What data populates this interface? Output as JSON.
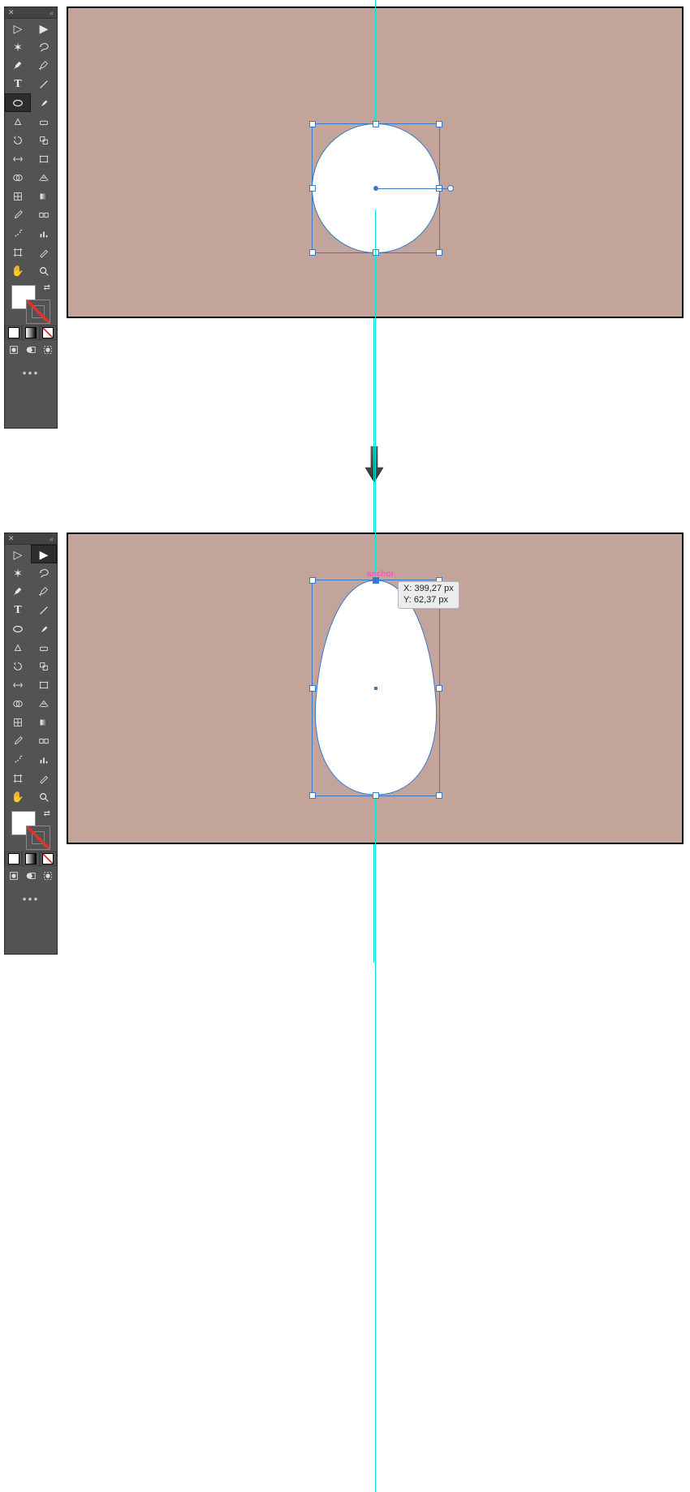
{
  "panel": {
    "title_hint": "toolbar"
  },
  "tools": [
    {
      "name": "selection-tool",
      "glyph": "▷"
    },
    {
      "name": "direct-selection-tool",
      "glyph": "▶"
    },
    {
      "name": "magic-wand-tool",
      "glyph": "✦"
    },
    {
      "name": "lasso-tool",
      "glyph": "∿"
    },
    {
      "name": "pen-tool",
      "glyph": "✒"
    },
    {
      "name": "curvature-tool",
      "glyph": "✎"
    },
    {
      "name": "type-tool",
      "glyph": "T"
    },
    {
      "name": "line-segment-tool",
      "glyph": "╱"
    },
    {
      "name": "ellipse-tool",
      "glyph": "◯"
    },
    {
      "name": "paintbrush-tool",
      "glyph": "🖌"
    },
    {
      "name": "shaper-tool",
      "glyph": "◇"
    },
    {
      "name": "eraser-tool",
      "glyph": "▭"
    },
    {
      "name": "rotate-tool",
      "glyph": "⟳"
    },
    {
      "name": "scale-tool",
      "glyph": "⤢"
    },
    {
      "name": "width-tool",
      "glyph": "↔"
    },
    {
      "name": "free-transform-tool",
      "glyph": "▱"
    },
    {
      "name": "shape-builder-tool",
      "glyph": "◐"
    },
    {
      "name": "perspective-grid-tool",
      "glyph": "▦"
    },
    {
      "name": "mesh-tool",
      "glyph": "▦"
    },
    {
      "name": "gradient-tool",
      "glyph": "▥"
    },
    {
      "name": "eyedropper-tool",
      "glyph": "⁃"
    },
    {
      "name": "blend-tool",
      "glyph": "◎"
    },
    {
      "name": "symbol-sprayer-tool",
      "glyph": "⁂"
    },
    {
      "name": "column-graph-tool",
      "glyph": "▥"
    },
    {
      "name": "slice-tool",
      "glyph": "▣"
    },
    {
      "name": "artboard-tool",
      "glyph": "▭"
    },
    {
      "name": "hand-tool",
      "glyph": "✋"
    },
    {
      "name": "zoom-tool",
      "glyph": "🔍"
    }
  ],
  "tooltip": {
    "line1": "X: 399,27 px",
    "line2": "Y: 62,37 px"
  },
  "anchor_label": "anchor",
  "chart_data": null
}
